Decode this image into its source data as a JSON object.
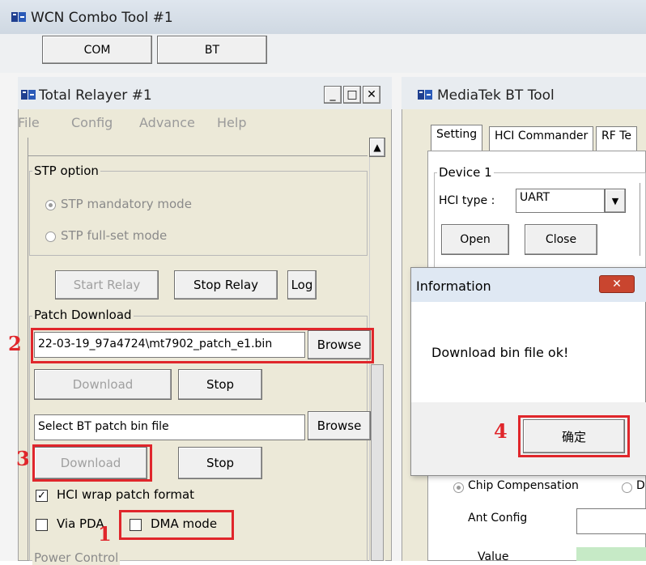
{
  "main_window": {
    "title": "WCN Combo Tool #1",
    "tabs": [
      "COM",
      "BT"
    ]
  },
  "relayer": {
    "title": "Total Relayer #1",
    "window_buttons": [
      "_",
      "□",
      "✕"
    ],
    "menu": [
      "File",
      "Config",
      "Advance",
      "Help"
    ],
    "stp": {
      "title": "STP option",
      "options": [
        "STP mandatory mode",
        "STP full-set mode"
      ],
      "selected": 0
    },
    "relay_buttons": {
      "start": "Start Relay",
      "stop": "Stop Relay",
      "log": "Log"
    },
    "patch": {
      "title": "Patch Download",
      "file_path": "22-03-19_97a4724\\mt7902_patch_e1.bin",
      "browse_label": "Browse",
      "download_label": "Download",
      "stop_label": "Stop",
      "bt_placeholder": "Select BT patch bin file",
      "browse2_label": "Browse",
      "download2_label": "Download",
      "stop2_label": "Stop",
      "hci_wrap_label": "HCI wrap patch format",
      "hci_wrap_checked": true,
      "via_pda_label": "Via PDA",
      "via_pda_checked": false,
      "dma_label": "DMA mode",
      "dma_checked": false
    },
    "power_title": "Power Control"
  },
  "bt_tool": {
    "title": "MediaTek BT Tool",
    "tabs": [
      "Setting",
      "HCI Commander",
      "RF Te"
    ],
    "device_title": "Device 1",
    "hci_type_label": "HCI type :",
    "hci_type_value": "UART",
    "open_label": "Open",
    "close_label": "Close",
    "chip_comp_label": "Chip Compensation",
    "chip_comp_checked": true,
    "radio2_label": "D",
    "ant_config_label": "Ant Config",
    "value_label": "Value"
  },
  "dialog": {
    "title": "Information",
    "message": "Download bin file ok!",
    "ok_label": "确定"
  },
  "annotations": [
    "1",
    "2",
    "3",
    "4"
  ],
  "colors": {
    "annotation_red": "#e0262b",
    "dialog_close_red": "#c9452f"
  }
}
